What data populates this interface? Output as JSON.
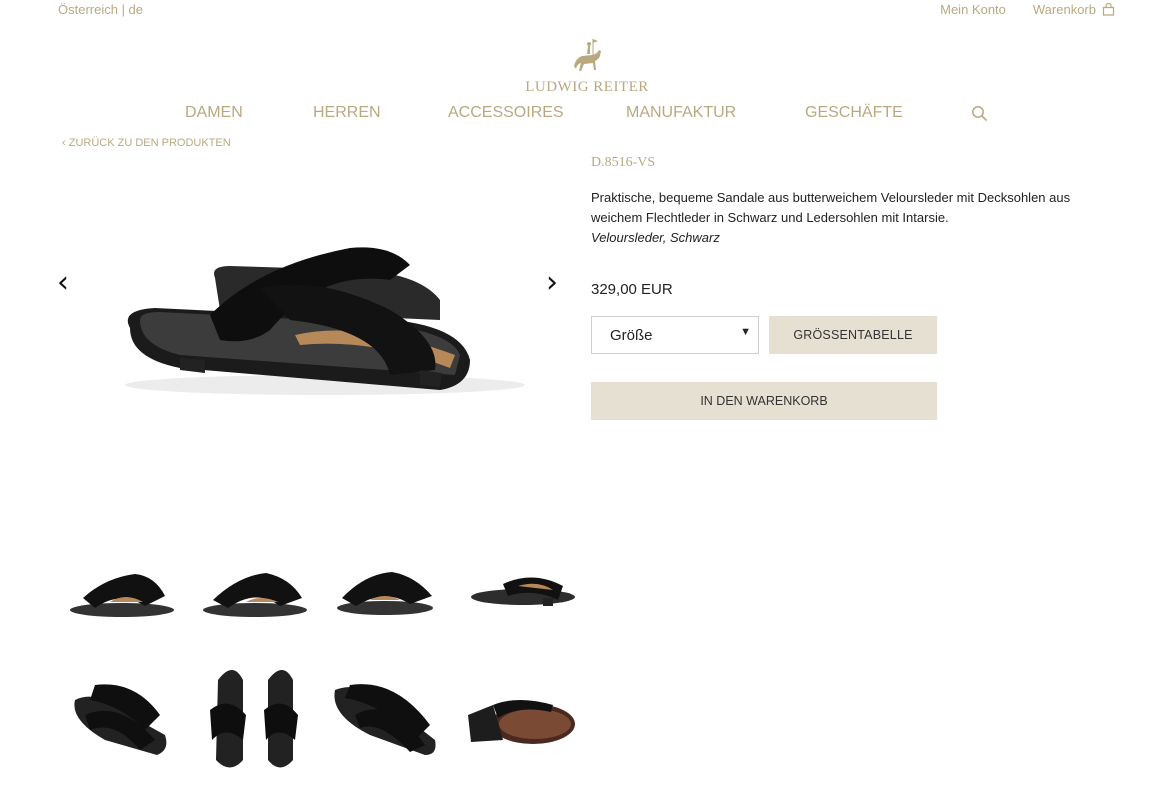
{
  "topbar": {
    "region": "Österreich | de",
    "account": "Mein Konto",
    "cart": "Warenkorb",
    "cart_icon": "bag-icon"
  },
  "brand": {
    "name": "LUDWIG REITER",
    "logo_icon": "horse-rider-icon"
  },
  "nav": {
    "items": [
      "DAMEN",
      "HERREN",
      "ACCESSOIRES",
      "MANUFAKTUR",
      "GESCHÄFTE"
    ],
    "search_icon": "search-icon"
  },
  "back_link": "ZURÜCK ZU DEN PRODUKTEN",
  "product": {
    "sku": "D.8516-VS",
    "description": "Praktische, bequeme Sandale aus butterweichem Veloursleder mit Decksohlen aus weichem Flechtleder in Schwarz und Ledersohlen mit Intarsie.",
    "material": "Veloursleder, Schwarz",
    "price": "329,00 EUR",
    "size_placeholder": "Größe",
    "size_table_label": "GRÖSSENTABELLE",
    "add_to_cart_label": "IN DEN WARENKORB"
  },
  "gallery": {
    "prev_icon": "chevron-left-icon",
    "next_icon": "chevron-right-icon",
    "prev": "‹",
    "next": "›",
    "thumbnail_count": 8
  },
  "colors": {
    "accent": "#b9a980",
    "button_bg": "#e6e0d2"
  }
}
